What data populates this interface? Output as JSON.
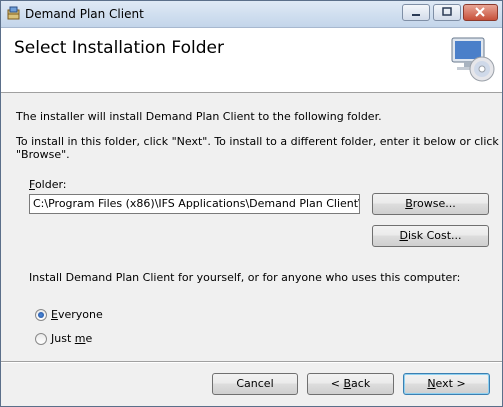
{
  "window": {
    "title": "Demand Plan Client"
  },
  "header": {
    "title": "Select Installation Folder"
  },
  "intro": {
    "line1": "The installer will install Demand Plan Client to the following folder.",
    "line2": "To install in this folder, click \"Next\". To install to a different folder, enter it below or click \"Browse\"."
  },
  "folder": {
    "label_prefix": "",
    "label_mnemonic": "F",
    "label_rest": "older:",
    "value": "C:\\Program Files (x86)\\IFS Applications\\Demand Plan Client\\"
  },
  "buttons": {
    "browse": {
      "mnemonic": "B",
      "rest": "rowse..."
    },
    "disk_cost": {
      "mnemonic": "D",
      "rest": "isk Cost..."
    },
    "cancel": "Cancel",
    "back": {
      "prefix": "< ",
      "mnemonic": "B",
      "rest": "ack"
    },
    "next": {
      "mnemonic": "N",
      "rest": "ext >"
    }
  },
  "install_for": {
    "question": "Install Demand Plan Client for yourself, or for anyone who uses this computer:",
    "everyone": {
      "mnemonic": "E",
      "rest": "veryone",
      "selected": true
    },
    "just_me": {
      "prefix": "Just ",
      "mnemonic": "m",
      "rest": "e",
      "selected": false
    }
  },
  "icons": {
    "app": "installer-box-icon",
    "header": "computer-disc-icon"
  }
}
